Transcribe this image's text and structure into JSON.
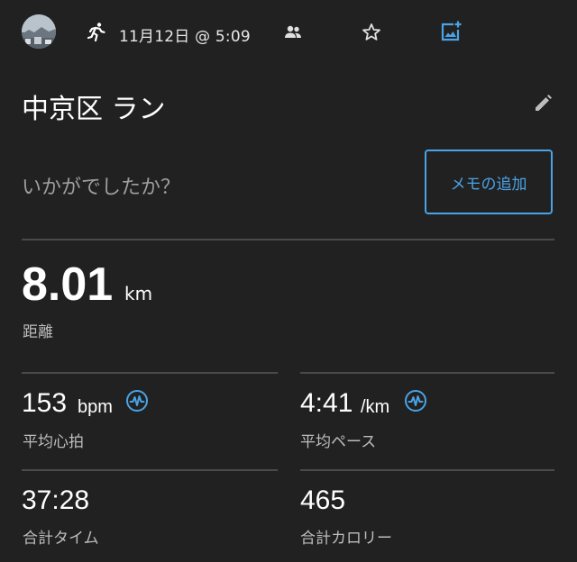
{
  "header": {
    "datetime": "11月12日 @ 5:09",
    "icons": [
      "avatar",
      "running-icon",
      "people-icon",
      "star-icon",
      "add-photo-icon"
    ]
  },
  "activity": {
    "title": "中京区 ラン",
    "memo_prompt": "いかがでしたか？",
    "memo_button": "メモの追加"
  },
  "distance": {
    "value": "8.01",
    "unit": "km",
    "label": "距離"
  },
  "stats": {
    "heart_rate": {
      "value": "153",
      "unit": "bpm",
      "label": "平均心拍"
    },
    "pace": {
      "value": "4:41",
      "unit": "/km",
      "label": "平均ペース"
    },
    "time": {
      "value": "37:28",
      "label": "合計タイム"
    },
    "calories": {
      "value": "465",
      "label": "合計カロリー"
    }
  },
  "colors": {
    "background": "#212121",
    "accent": "#4aa3e6",
    "text": "#ffffff",
    "secondary_text": "#bdbdbd",
    "divider": "#4a4a4a"
  }
}
